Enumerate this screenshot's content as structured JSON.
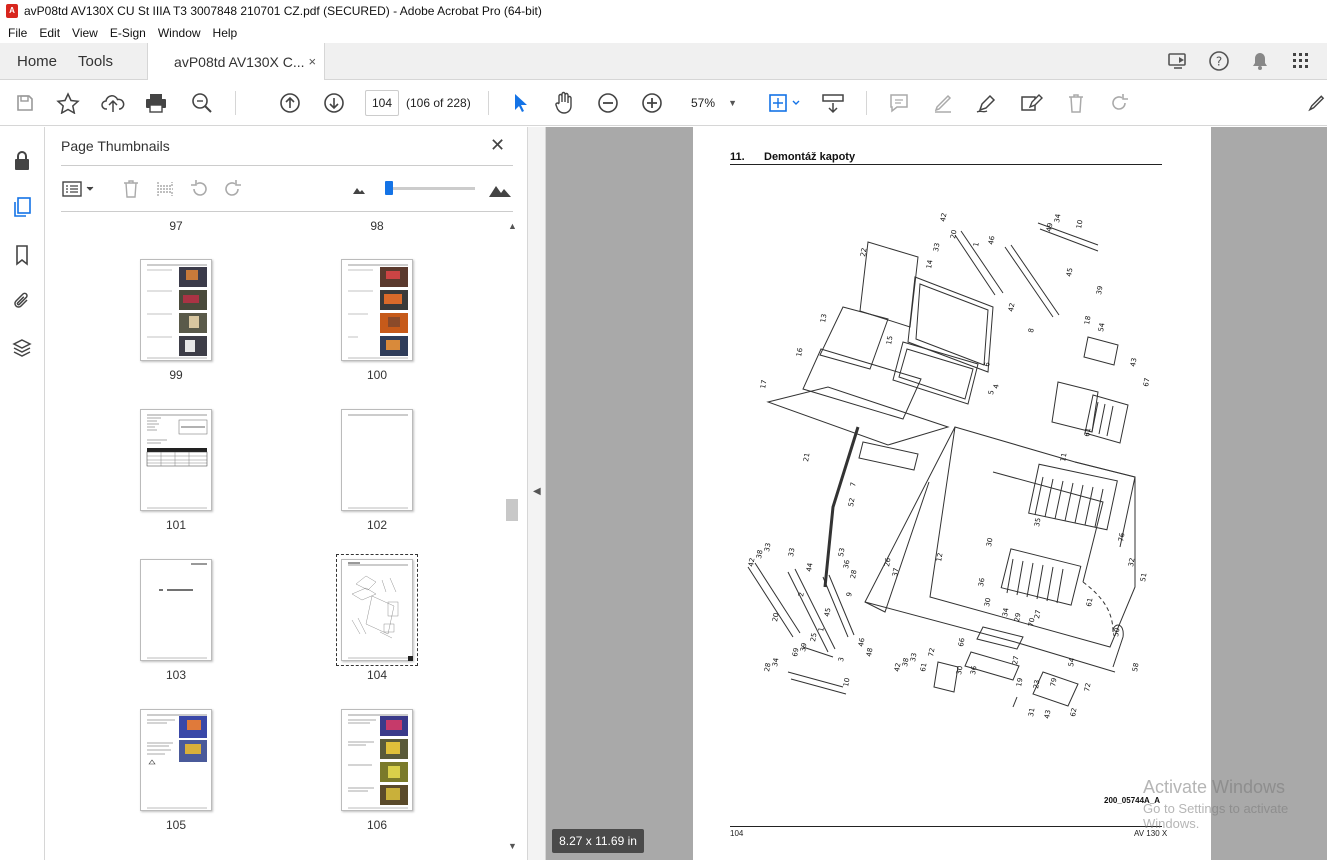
{
  "window": {
    "title": "avP08td AV130X CU St IIIA T3 3007848 210701 CZ.pdf (SECURED) - Adobe Acrobat Pro (64-bit)"
  },
  "menu": [
    "File",
    "Edit",
    "View",
    "E-Sign",
    "Window",
    "Help"
  ],
  "tabs": {
    "home": "Home",
    "tools": "Tools",
    "document": "avP08td AV130X C...",
    "close": "×"
  },
  "toolbar": {
    "page_number": "104",
    "page_count": "(106 of 228)",
    "zoom": "57%"
  },
  "thumbnails_panel": {
    "title": "Page Thumbnails",
    "close": "✕",
    "pages": [
      {
        "label": "97",
        "kind": "label-only"
      },
      {
        "label": "98",
        "kind": "label-only"
      },
      {
        "label": "99",
        "kind": "photos"
      },
      {
        "label": "100",
        "kind": "photos"
      },
      {
        "label": "101",
        "kind": "table"
      },
      {
        "label": "102",
        "kind": "blank"
      },
      {
        "label": "103",
        "kind": "title"
      },
      {
        "label": "104",
        "kind": "drawing",
        "selected": true
      },
      {
        "label": "105",
        "kind": "photos-blue"
      },
      {
        "label": "106",
        "kind": "photos-mixed"
      }
    ]
  },
  "document": {
    "section_number": "11.",
    "section_title": "Demontáž kapoty",
    "figure_code": "200_05744A_A",
    "footer_page": "104",
    "footer_model": "AV 130 X"
  },
  "status": {
    "page_size": "8.27 x 11.69 in"
  },
  "watermark": {
    "line1": "Activate Windows",
    "line2": "Go to Settings to activate Windows."
  },
  "colors": {
    "accent": "#1473e6",
    "doc_background": "#a9a9a9",
    "tab_bar": "#f0f0f0"
  }
}
